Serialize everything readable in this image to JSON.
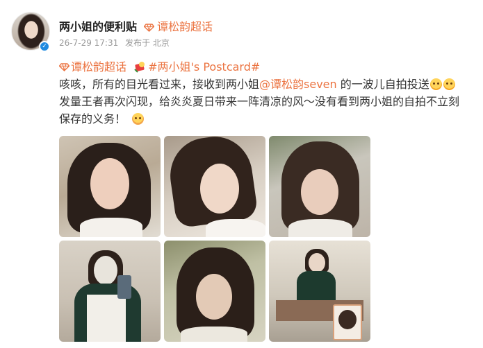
{
  "post": {
    "author": "两小姐的便利贴",
    "super_topic": "谭松韵超话",
    "time": "26-7-29 17:31",
    "source": "发布于 北京"
  },
  "content": {
    "topic_tag": "谭松韵超话",
    "hashtag": "#两小姐's Postcard#",
    "line1_a": "咳咳，所有的目光看过来，接收到两小姐",
    "mention": "@谭松韵seven",
    "line1_b": " 的一波儿自拍投送",
    "line2": "发量王者再次闪现，给炎炎夏日带来一阵清凉的风～没有看到两小姐的自拍不立刻",
    "line3": "保存的义务！"
  },
  "icons": {
    "verified": "verified-badge-icon",
    "diamond": "diamond-icon",
    "emoji": "laughing-emoji-icon"
  },
  "colors": {
    "accent": "#eb7340",
    "verified": "#1f8ae0"
  },
  "photos": [
    {
      "name": "selfie-1"
    },
    {
      "name": "selfie-2"
    },
    {
      "name": "selfie-3"
    },
    {
      "name": "selfie-4"
    },
    {
      "name": "selfie-5"
    },
    {
      "name": "selfie-6"
    }
  ]
}
